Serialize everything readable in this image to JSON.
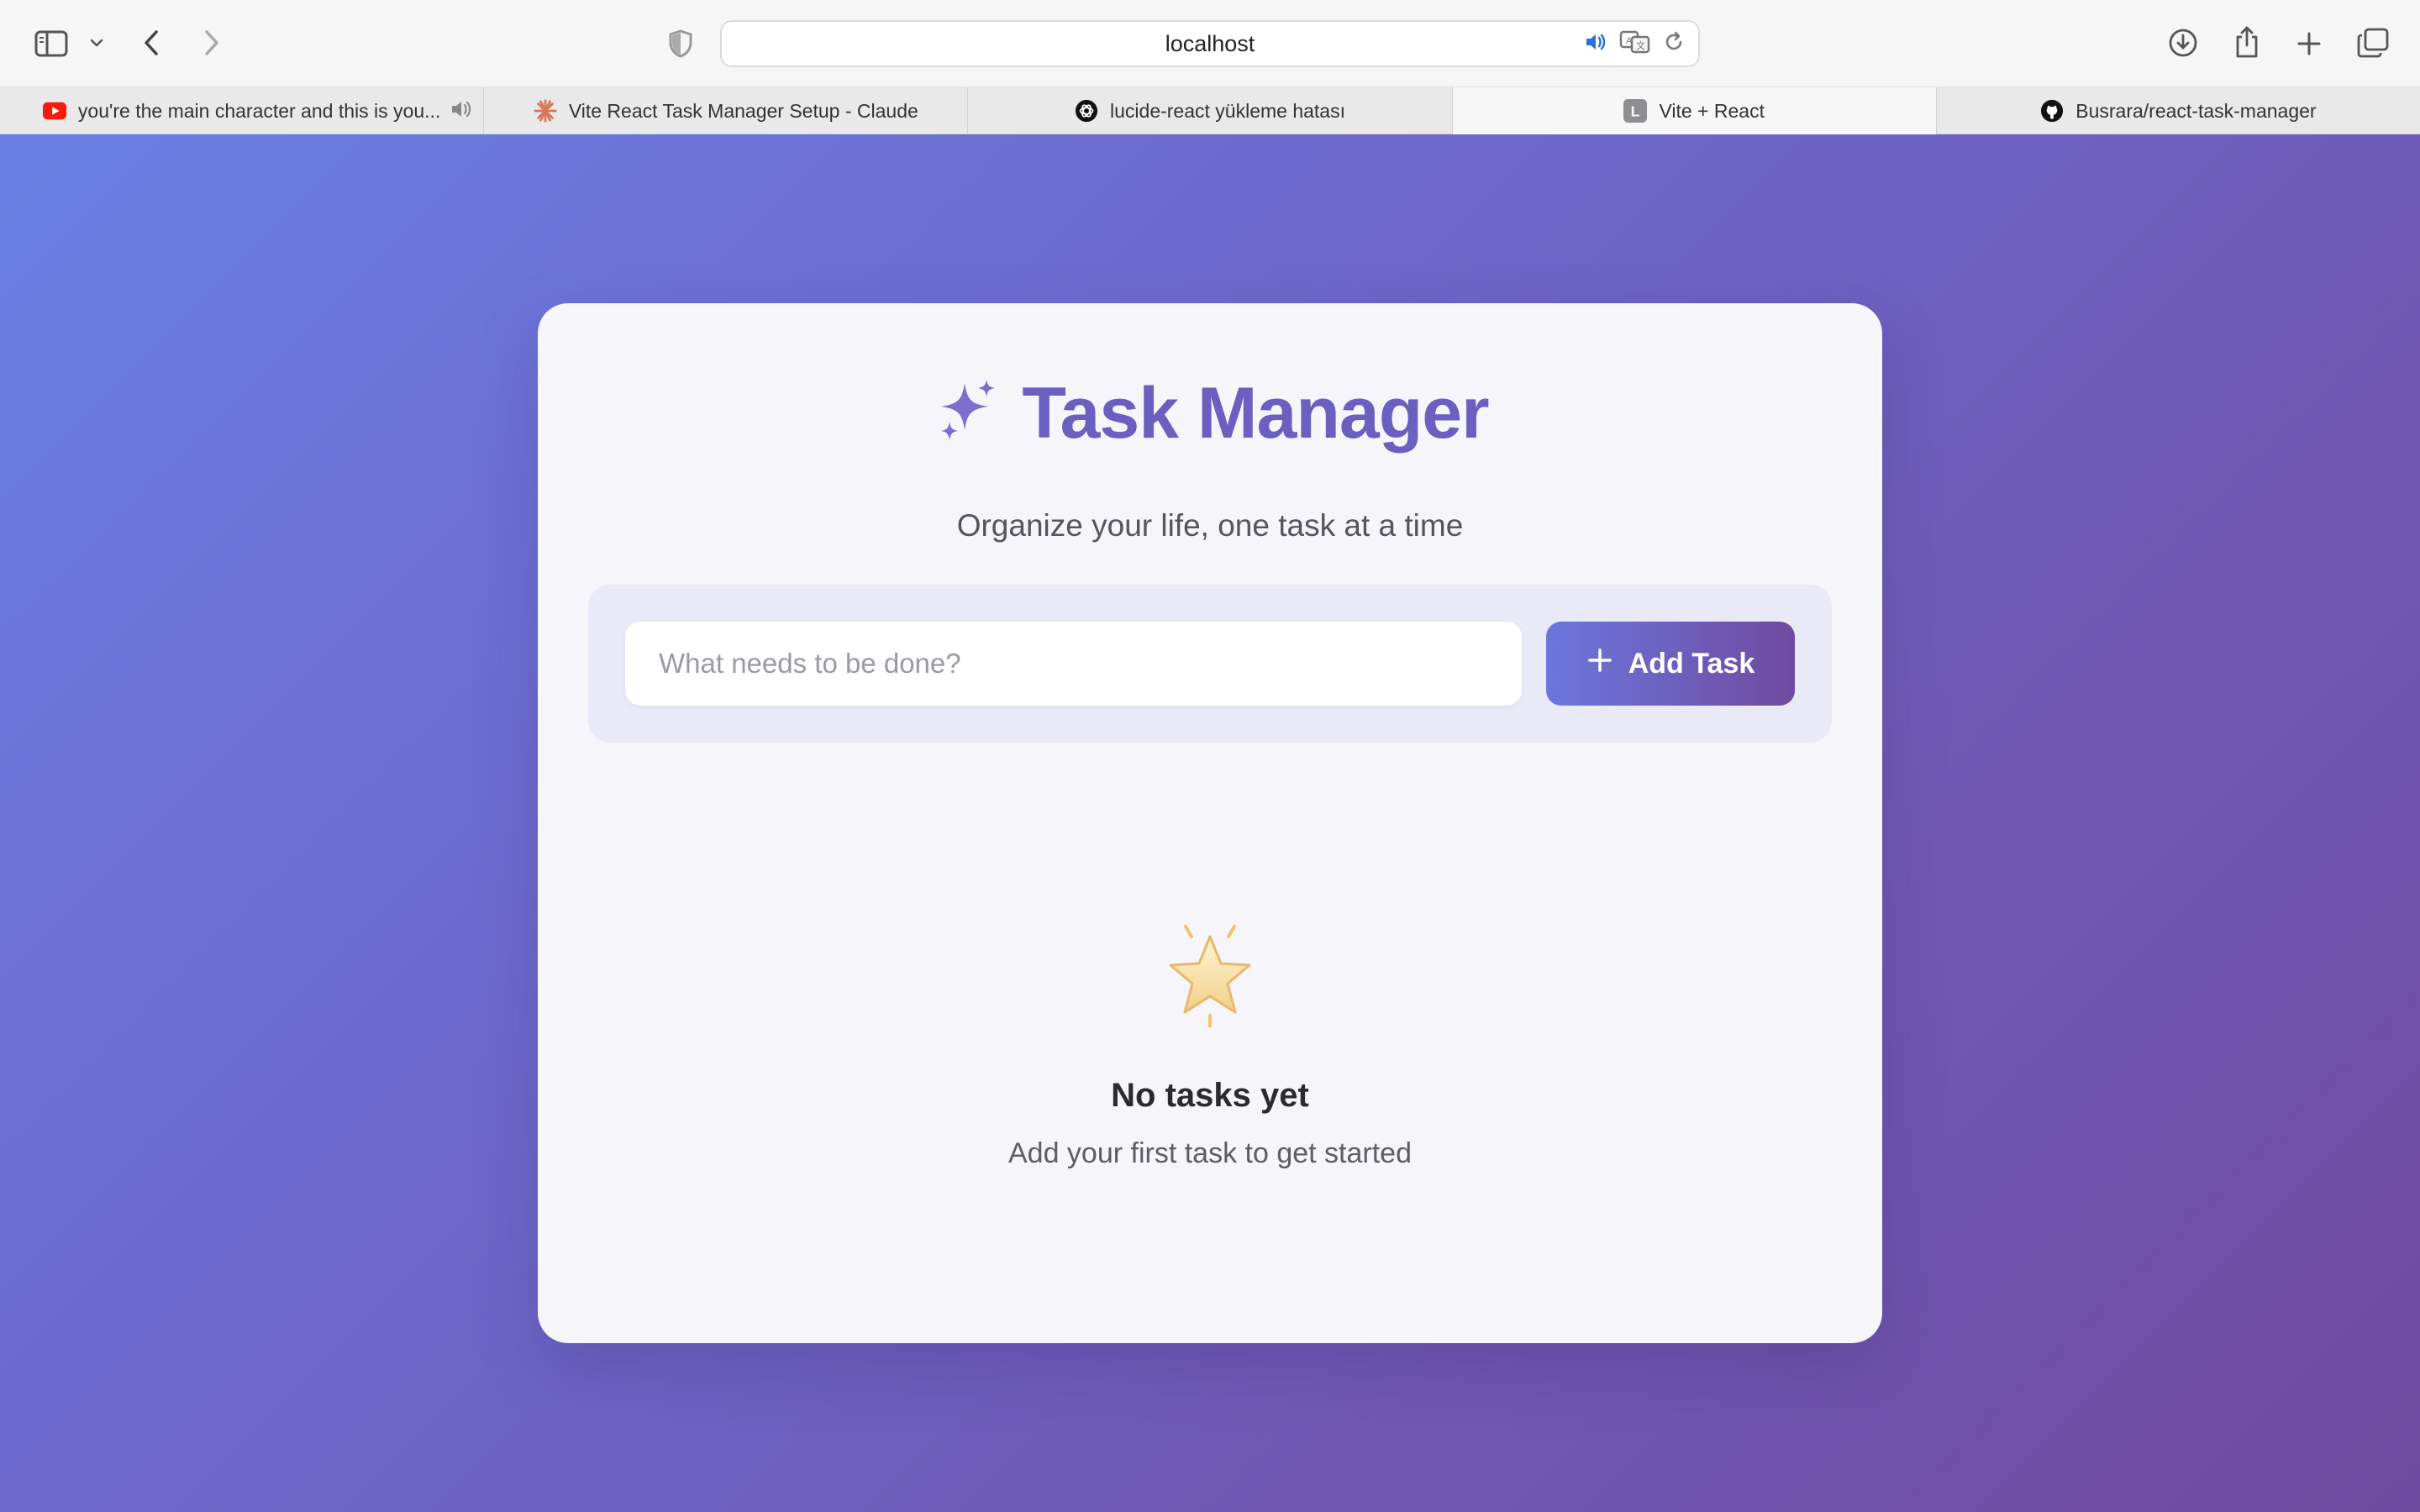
{
  "browser": {
    "url": "localhost",
    "tabs": [
      {
        "title": "you're the main character and this is you...",
        "favicon": "youtube-icon",
        "audio": true,
        "active": false
      },
      {
        "title": "Vite React Task Manager Setup - Claude",
        "favicon": "claude-icon",
        "active": false
      },
      {
        "title": "lucide-react yükleme hatası",
        "favicon": "chatgpt-icon",
        "active": false
      },
      {
        "title": "Vite + React",
        "favicon": "letter-l-icon",
        "favicon_letter": "L",
        "active": true
      },
      {
        "title": "Busrara/react-task-manager",
        "favicon": "github-icon",
        "active": false
      }
    ]
  },
  "app": {
    "title": "Task Manager",
    "title_icon": "sparkles-icon",
    "subtitle": "Organize your life, one task at a time",
    "input_placeholder": "What needs to be done?",
    "add_button_label": "Add Task",
    "empty_state": {
      "icon": "glowing-star-icon",
      "title": "No tasks yet",
      "subtitle": "Add your first task to get started"
    }
  },
  "colors": {
    "background_gradient": [
      "#6a7fe4",
      "#704a9f"
    ],
    "title": "#6b5fc0",
    "button_gradient": [
      "#6b77dd",
      "#704aa0"
    ]
  }
}
